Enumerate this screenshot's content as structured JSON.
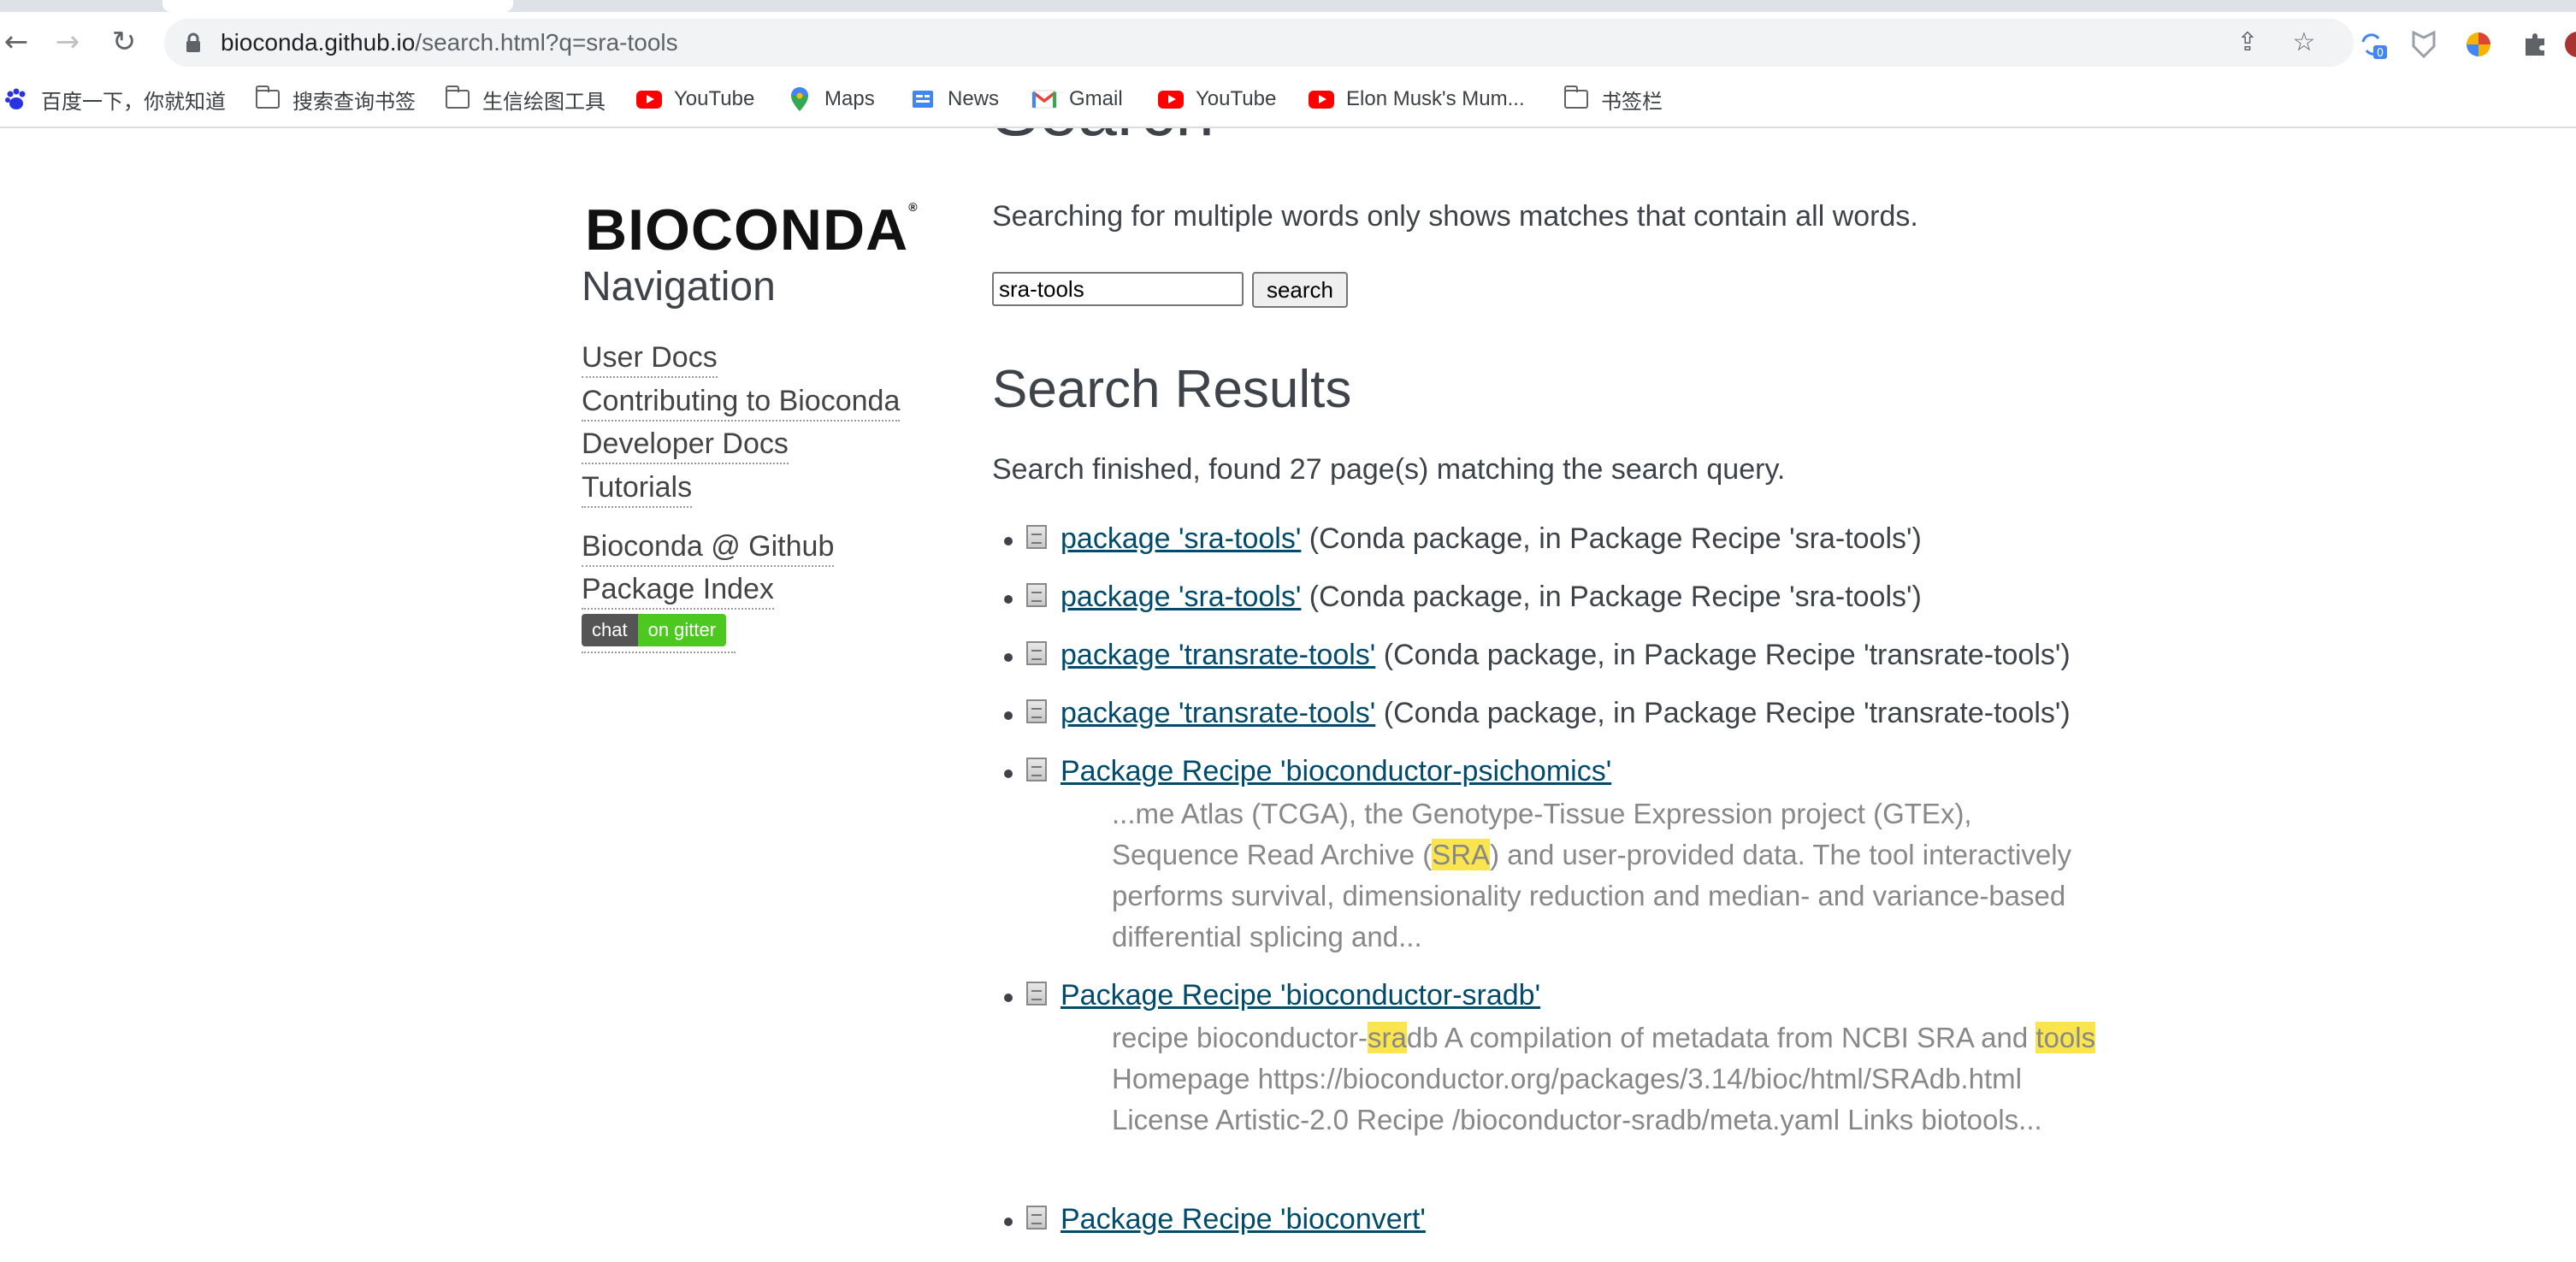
{
  "browser": {
    "url_host": "bioconda.github.io",
    "url_path": "/search.html?q=sra-tools",
    "extension_badge": "0",
    "bookmarks": [
      {
        "label": "百度一下，你就知道",
        "icon": "baidu-paw-icon"
      },
      {
        "label": "搜索查询书签",
        "icon": "folder-icon"
      },
      {
        "label": "生信绘图工具",
        "icon": "folder-icon"
      },
      {
        "label": "YouTube",
        "icon": "youtube-icon"
      },
      {
        "label": "Maps",
        "icon": "maps-icon"
      },
      {
        "label": "News",
        "icon": "google-news-icon"
      },
      {
        "label": "Gmail",
        "icon": "gmail-icon"
      },
      {
        "label": "YouTube",
        "icon": "youtube-icon"
      },
      {
        "label": "Elon Musk's Mum...",
        "icon": "youtube-icon"
      },
      {
        "label": "书签栏",
        "icon": "folder-icon"
      }
    ]
  },
  "sidebar": {
    "logo_text": "BIOCONDA",
    "heading": "Navigation",
    "links": [
      "User Docs",
      "Contributing to Bioconda",
      "Developer Docs",
      "Tutorials"
    ],
    "extra_links": [
      "Bioconda @ Github",
      "Package Index"
    ],
    "badge": {
      "left": "chat",
      "right": "on gitter"
    }
  },
  "main": {
    "title": "Search",
    "intro": "Searching for multiple words only shows matches that contain all words.",
    "search_value": "sra-tools",
    "search_button": "search",
    "results_heading": "Search Results",
    "summary": "Search finished, found 27 page(s) matching the search query.",
    "results": [
      {
        "link": "package 'sra-tools'",
        "meta": " (Conda package, in Package Recipe 'sra-tools')"
      },
      {
        "link": "package 'sra-tools'",
        "meta": " (Conda package, in Package Recipe 'sra-tools')"
      },
      {
        "link": "package 'transrate-tools'",
        "meta": " (Conda package, in Package Recipe 'transrate-tools')"
      },
      {
        "link": "package 'transrate-tools'",
        "meta": " (Conda package, in Package Recipe 'transrate-tools')"
      },
      {
        "link": "Package Recipe 'bioconductor-psichomics'",
        "context": {
          "before": "...me Atlas (TCGA), the Genotype-Tissue Expression project (GTEx), Sequence Read Archive (",
          "hl1": "SRA",
          "after": ") and user-provided data. The tool interactively performs survival, dimensionality reduction and median- and variance-based differential splicing and..."
        }
      },
      {
        "link": "Package Recipe 'bioconductor-sradb'",
        "context": {
          "before": "recipe bioconductor-",
          "hl1": "sra",
          "mid": "db A compilation of metadata from NCBI SRA and ",
          "hl2": "tools",
          "after": " Homepage https://bioconductor.org/packages/3.14/bioc/html/SRAdb.html License Artistic-2.0 Recipe /bioconductor-sradb/meta.yaml Links biotools..."
        }
      },
      {
        "link": "Package Recipe 'bioconvert'"
      }
    ]
  }
}
